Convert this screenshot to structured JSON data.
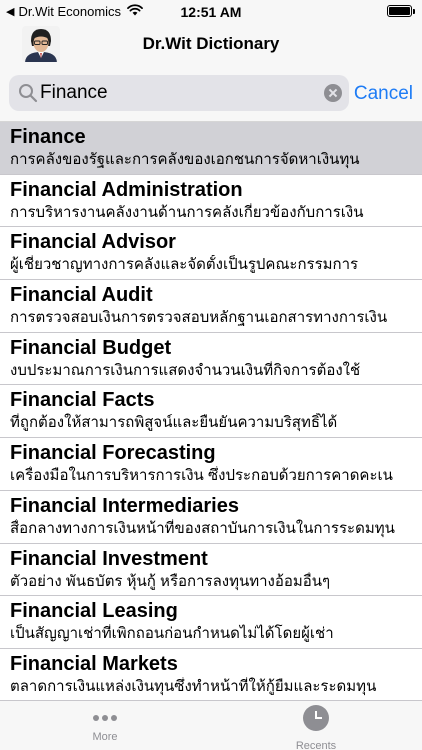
{
  "status_bar": {
    "back_app": "Dr.Wit Economics",
    "time": "12:51 AM"
  },
  "nav": {
    "title": "Dr.Wit Dictionary"
  },
  "search": {
    "value": "Finance",
    "cancel_label": "Cancel"
  },
  "results": [
    {
      "term": "Finance",
      "definition": "การคลังของรัฐและการคลังของเอกชนการจัดหาเงินทุน"
    },
    {
      "term": "Financial Administration",
      "definition": "การบริหารงานคลังงานด้านการคลังเกี่ยวข้องกับการเงิน"
    },
    {
      "term": "Financial Advisor",
      "definition": "ผู้เชี่ยวชาญทางการคลังและจัดตั้งเป็นรูปคณะกรรมการ"
    },
    {
      "term": "Financial Audit",
      "definition": "การตรวจสอบเงินการตรวจสอบหลักฐานเอกสารทางการเงิน"
    },
    {
      "term": "Financial Budget",
      "definition": "งบประมาณการเงินการแสดงจำนวนเงินที่กิจการต้องใช้"
    },
    {
      "term": "Financial Facts",
      "definition": "ที่ถูกต้องให้สามารถพิสูจน์และยืนยันความบริสุทธิ์ได้"
    },
    {
      "term": "Financial Forecasting",
      "definition": "เครื่องมือในการบริหารการเงิน ซึ่งประกอบด้วยการคาดคะเน"
    },
    {
      "term": "Financial Intermediaries",
      "definition": "สื่อกลางทางการเงินหน้าที่ของสถาบันการเงินในการระดมทุน"
    },
    {
      "term": "Financial Investment",
      "definition": "ตัวอย่าง พันธบัตร หุ้นกู้ หรือการลงทุนทางอ้อมอื่นๆ"
    },
    {
      "term": "Financial Leasing",
      "definition": "เป็นสัญญาเช่าที่เพิกถอนก่อนกำหนดไม่ได้โดยผู้เช่า"
    },
    {
      "term": "Financial Markets",
      "definition": "ตลาดการเงินแหล่งเงินทุนซึ่งทำหน้าที่ให้กู้ยืมและระดมทุน"
    }
  ],
  "tabs": [
    {
      "label": "More",
      "icon": "more-dots-icon"
    },
    {
      "label": "Recents",
      "icon": "clock-icon"
    }
  ],
  "colors": {
    "accent": "#1e7cf5",
    "selected_row": "#d1d1d6",
    "tab_inactive": "#8e8e93"
  }
}
